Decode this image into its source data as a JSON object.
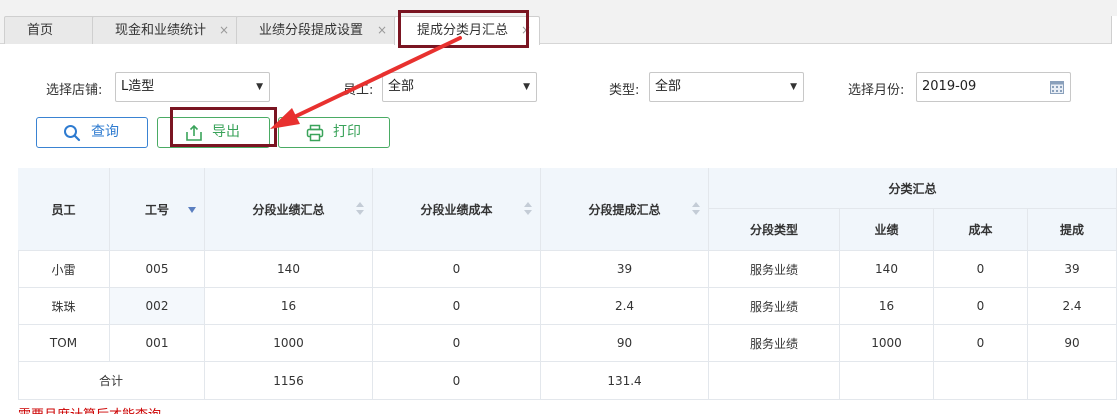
{
  "tabs": [
    {
      "label": "首页",
      "closable": false
    },
    {
      "label": "现金和业绩统计",
      "closable": true
    },
    {
      "label": "业绩分段提成设置",
      "closable": true
    },
    {
      "label": "提成分类月汇总",
      "closable": true,
      "active": true
    }
  ],
  "tab_close_glyph": "×",
  "filters": {
    "store_label": "选择店铺:",
    "store_value": "L造型",
    "employee_label": "员工:",
    "employee_value": "全部",
    "type_label": "类型:",
    "type_value": "全部",
    "month_label": "选择月份:",
    "month_value": "2019-09"
  },
  "buttons": {
    "query": "查询",
    "export": "导出",
    "print": "打印"
  },
  "table": {
    "headers": {
      "employee": "员工",
      "emp_no": "工号",
      "seg_perf_total": "分段业绩汇总",
      "seg_perf_cost": "分段业绩成本",
      "seg_comm_total": "分段提成汇总",
      "category_group": "分类汇总",
      "seg_type": "分段类型",
      "perf": "业绩",
      "cost": "成本",
      "comm": "提成"
    },
    "rows": [
      {
        "employee": "小雷",
        "emp_no": "005",
        "seg_perf_total": "140",
        "seg_perf_cost": "0",
        "seg_comm_total": "39",
        "seg_type": "服务业绩",
        "perf": "140",
        "cost": "0",
        "comm": "39"
      },
      {
        "employee": "珠珠",
        "emp_no": "002",
        "seg_perf_total": "16",
        "seg_perf_cost": "0",
        "seg_comm_total": "2.4",
        "seg_type": "服务业绩",
        "perf": "16",
        "cost": "0",
        "comm": "2.4"
      },
      {
        "employee": "TOM",
        "emp_no": "001",
        "seg_perf_total": "1000",
        "seg_perf_cost": "0",
        "seg_comm_total": "90",
        "seg_type": "服务业绩",
        "perf": "1000",
        "cost": "0",
        "comm": "90"
      }
    ],
    "total": {
      "label": "合计",
      "seg_perf_total": "1156",
      "seg_perf_cost": "0",
      "seg_comm_total": "131.4"
    }
  },
  "footnote": "需要月度计算后才能查询",
  "colors": {
    "highlight": "#7a1522",
    "arrow": "#e8312f",
    "blue": "#2e7bd0",
    "green": "#3aa35a",
    "header_bg": "#f1f6fb"
  },
  "icons": {
    "query": "search-icon",
    "export": "export-icon",
    "print": "printer-icon",
    "month": "calendar-icon"
  }
}
